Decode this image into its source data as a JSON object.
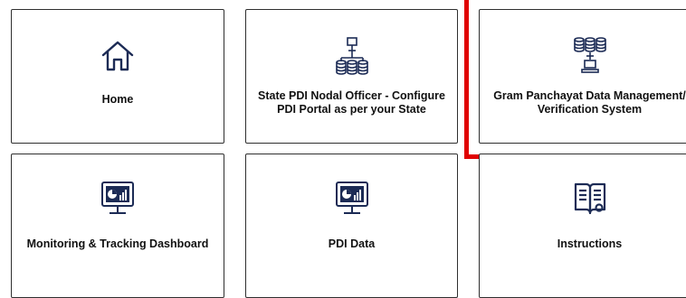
{
  "tiles": {
    "home": {
      "label": "Home",
      "icon": "home-icon"
    },
    "state_pdi": {
      "label": "State PDI Nodal Officer - Configure PDI Portal as per your State",
      "icon": "database-network-icon"
    },
    "gram_panchayat": {
      "label": "Gram Panchayat Data Management/ Verification System",
      "icon": "database-computer-icon"
    },
    "monitoring": {
      "label": "Monitoring & Tracking Dashboard",
      "icon": "dashboard-monitor-icon"
    },
    "pdi_data": {
      "label": "PDI Data",
      "icon": "dashboard-monitor-icon"
    },
    "instructions": {
      "label": "Instructions",
      "icon": "book-icon"
    }
  },
  "colors": {
    "icon": "#1c2b55",
    "highlight": "#e00000",
    "border": "#2f2f2f"
  }
}
